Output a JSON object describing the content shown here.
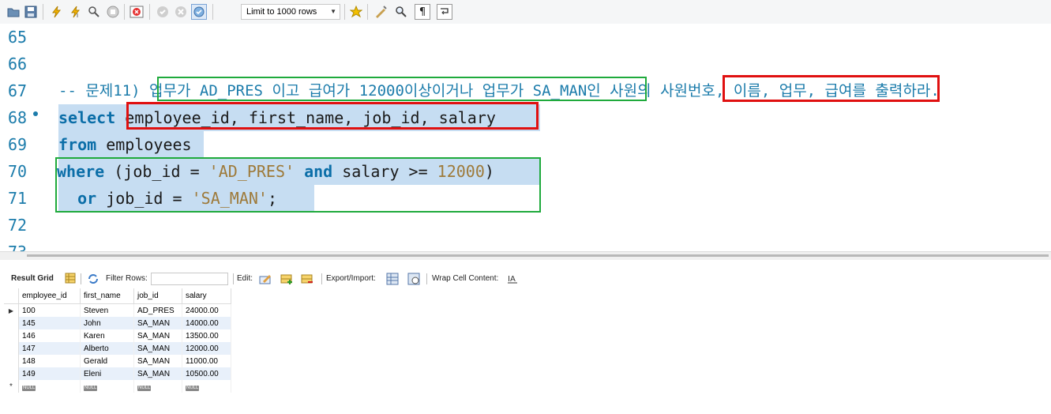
{
  "toolbar": {
    "limit_label": "Limit to 1000 rows",
    "icons": [
      "open-folder-icon",
      "save-icon",
      "execute-icon",
      "execute-statement-icon",
      "explain-icon",
      "stop-icon",
      "toggle-error-icon",
      "commit-icon",
      "rollback-icon",
      "autocommit-icon",
      "beautify-icon",
      "find-icon",
      "invisibles-icon",
      "wrap-icon",
      "add-snippet-icon"
    ]
  },
  "editor": {
    "line_numbers": [
      "65",
      "66",
      "67",
      "68",
      "69",
      "70",
      "71",
      "72",
      "73"
    ],
    "line67": {
      "comment": "-- 문제11) ",
      "cond1": "업무가 AD_PRES 이고 급여가 12000이상이거나 업무가 SA_MAN",
      "mid": "인 사원의 ",
      "cols": "사원번호, 이름, 업무, 급여",
      "end": "를 출력하라."
    },
    "line68": {
      "kw": "select",
      "sp": " ",
      "cols": "employee_id, first_name, job_id, salary"
    },
    "line69": {
      "kw": "from",
      "rest": " employees "
    },
    "line70": {
      "kw1": "where",
      "p1": " (job_id = ",
      "s1": "'AD_PRES'",
      "sp": " ",
      "kw2": "and",
      "p2": " salary >= ",
      "n1": "12000",
      "p3": ")"
    },
    "line71": {
      "indent": "  ",
      "kw": "or",
      "p1": " job_id = ",
      "s1": "'SA_MAN'",
      "end": ";"
    },
    "colors": {
      "keyword": "#0b6ea8",
      "string": "#9e7a3a",
      "line_number": "#1c7cab",
      "selection": "#c6ddf2",
      "green_box": "#1faa3c",
      "red_box": "#e01010"
    }
  },
  "result_bar": {
    "result_grid": "Result Grid",
    "filter_rows": "Filter Rows:",
    "edit": "Edit:",
    "export_import": "Export/Import:",
    "wrap_cell": "Wrap Cell Content:"
  },
  "grid": {
    "columns": [
      "employee_id",
      "first_name",
      "job_id",
      "salary"
    ],
    "rows": [
      [
        "100",
        "Steven",
        "AD_PRES",
        "24000.00"
      ],
      [
        "145",
        "John",
        "SA_MAN",
        "14000.00"
      ],
      [
        "146",
        "Karen",
        "SA_MAN",
        "13500.00"
      ],
      [
        "147",
        "Alberto",
        "SA_MAN",
        "12000.00"
      ],
      [
        "148",
        "Gerald",
        "SA_MAN",
        "11000.00"
      ],
      [
        "149",
        "Eleni",
        "SA_MAN",
        "10500.00"
      ]
    ],
    "null_label": "NULL",
    "current_marker": "▶",
    "new_row_marker": "*"
  }
}
